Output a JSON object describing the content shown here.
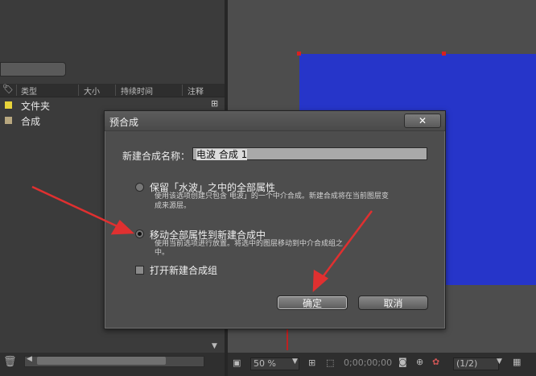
{
  "project_panel": {
    "columns": [
      "类型",
      "大小",
      "持续时间",
      "注释"
    ],
    "rows": [
      {
        "name": "文件夹",
        "color": "#e8d43a"
      },
      {
        "name": "合成",
        "color": "#b8a880"
      }
    ]
  },
  "dialog": {
    "title": "预合成",
    "close_label": "✕",
    "name_label": "新建合成名称：",
    "name_value": "电波 合成 1",
    "option1_title": "保留「水波」之中的全部属性",
    "option1_desc_line1": "使用该选项创建只包含 电波」的一个中介合成。新建合成将在当前图层变",
    "option1_desc_line2": "成来源层。",
    "option2_title": "移动全部属性到新建合成中",
    "option2_desc_line1": "使用当前选项进行放置。将选中的图层移动到中介合成组之",
    "option2_desc_line2": "中。",
    "checkbox_label": "打开新建合成组",
    "ok_label": "确定",
    "cancel_label": "取消"
  },
  "viewer_toolbar": {
    "zoom": "50 %",
    "timecode": "0;00;00;00",
    "resolution": "(1/2)"
  },
  "colors": {
    "solid_layer": "#2635c9",
    "arrow": "#e03030"
  }
}
